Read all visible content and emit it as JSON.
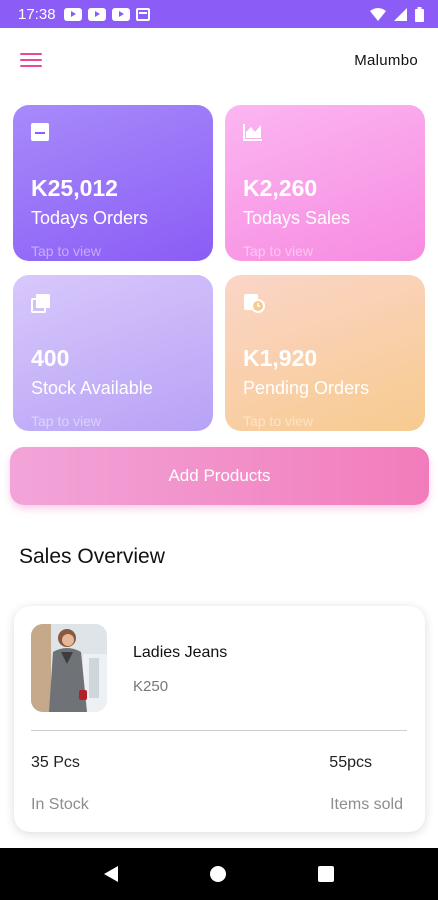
{
  "status_bar": {
    "time": "17:38"
  },
  "app_bar": {
    "user_name": "Malumbo"
  },
  "cards": [
    {
      "amount": "K25,012",
      "label": "Todays Orders",
      "hint": "Tap to view",
      "icon": "inbox-icon"
    },
    {
      "amount": "K2,260",
      "label": "Todays Sales",
      "hint": "Tap to view",
      "icon": "chart-icon"
    },
    {
      "amount": "400",
      "label": "Stock Available",
      "hint": "Tap to view",
      "icon": "stack-icon"
    },
    {
      "amount": "K1,920",
      "label": "Pending Orders",
      "hint": "Tap to view",
      "icon": "clock-icon"
    }
  ],
  "add_button": {
    "label": "Add Products"
  },
  "sales_overview": {
    "title": "Sales Overview",
    "product": {
      "name": "Ladies Jeans",
      "price": "K250",
      "in_stock_value": "35 Pcs",
      "in_stock_label": "In Stock",
      "sold_value": "55pcs",
      "sold_label": "Items sold"
    }
  },
  "colors": {
    "accent": "#ec4899",
    "status_bar": "#8b5cf6",
    "nav_bar": "#000000"
  }
}
